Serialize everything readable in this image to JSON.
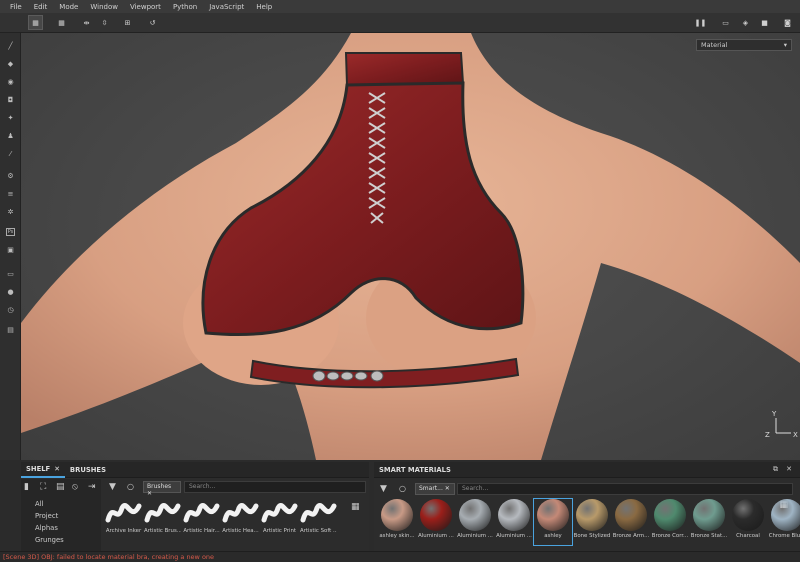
{
  "menu": [
    "File",
    "Edit",
    "Mode",
    "Window",
    "Viewport",
    "Python",
    "JavaScript",
    "Help"
  ],
  "viewport": {
    "material_select": "Material"
  },
  "shelf": {
    "tabs": [
      {
        "label": "SHELF"
      },
      {
        "label": "BRUSHES"
      }
    ],
    "filter_chip": "Brushes",
    "search_placeholder": "Search...",
    "categories": [
      "All",
      "Project",
      "Alphas",
      "Grunges"
    ],
    "brushes": [
      "Archive Inker",
      "Artistic Brus...",
      "Artistic Hair...",
      "Artistic Hea...",
      "Artistic Print",
      "Artistic Soft ..."
    ]
  },
  "smart_materials": {
    "title": "SMART MATERIALS",
    "filter_chip": "Smart...",
    "search_placeholder": "Search...",
    "items": [
      {
        "label": "ashley skin...",
        "color": "#c89a86"
      },
      {
        "label": "Aluminium ...",
        "color": "#9b1f1a"
      },
      {
        "label": "Aluminium ...",
        "color": "#a7adb2"
      },
      {
        "label": "Aluminium ...",
        "color": "#b6babf"
      },
      {
        "label": "ashley",
        "color": "#c48977"
      },
      {
        "label": "Bone Stylized",
        "color": "#b89a6a"
      },
      {
        "label": "Bronze Arm...",
        "color": "#8a6a42"
      },
      {
        "label": "Bronze Corr...",
        "color": "#4f8a6e"
      },
      {
        "label": "Bronze Stat...",
        "color": "#6f9c8f"
      },
      {
        "label": "Charcoal",
        "color": "#2b2b2b"
      },
      {
        "label": "Chrome Blu...",
        "color": "#9fb4c4"
      }
    ]
  },
  "status": "[Scene 3D] OBJ: failed to locate material bra, creating a new one"
}
